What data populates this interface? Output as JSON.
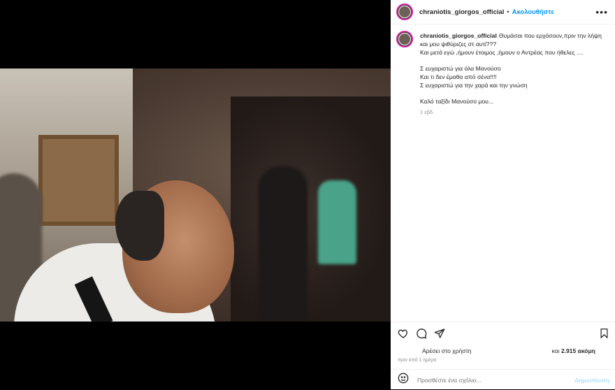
{
  "post": {
    "username": "chraniotis_giorgos_official",
    "separator": "•",
    "follow_label": "Ακολουθήστε",
    "more_label": "•••"
  },
  "caption": {
    "username": "chraniotis_giorgos_official",
    "first_line": "Θυμάσαι που ερχόσουν,πριν την λήψη και μου ψιθύριζες στ αυτί???",
    "line2": "Και μετά εγώ ,ήμουν έτοιμος ,ήμουν ο Αντρέας που ήθελες ....",
    "line3": "Σ ευχαριστώ για όλα Μανούσο",
    "line4": "Και τι δεν έμαθα από σένα!!!!",
    "line5": "Σ ευχαριστώ για την χαρά και την γνώση",
    "line6": "Καλό ταξίδι Μανούσο μου...",
    "time": "1 εβδ."
  },
  "engagement": {
    "likes_prefix": "Αρέσει στο χρήστη",
    "likes_and": "και",
    "likes_count": "2.915 ακόμη",
    "posted_time": "πριν από 1 ημέρα"
  },
  "comment": {
    "placeholder": "Προσθέστε ένα σχόλιο...",
    "post_label": "Δημοσίευση"
  },
  "icons": {
    "like": "heart-icon",
    "comment": "comment-icon",
    "share": "share-icon",
    "save": "bookmark-icon",
    "emoji": "emoji-icon"
  },
  "colors": {
    "link": "#0095f6",
    "post_disabled": "#b2dffc",
    "avatar_ring": "#d6249f"
  }
}
